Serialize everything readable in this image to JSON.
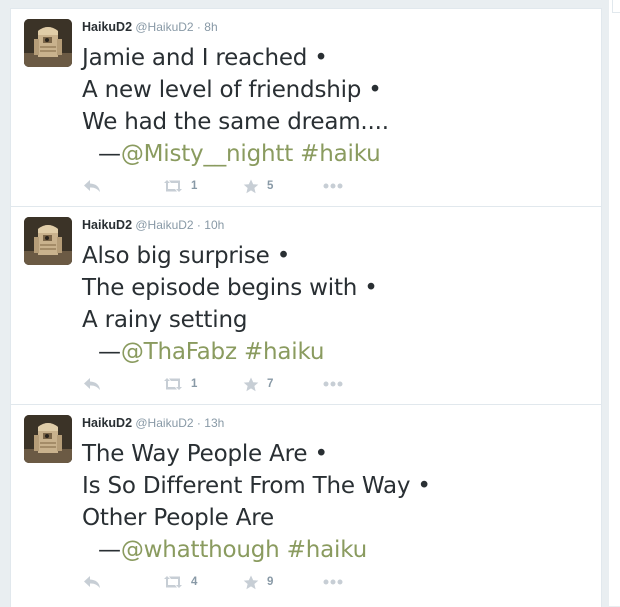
{
  "tweets": [
    {
      "author_name": "HaikuD2",
      "handle": "@HaikuD2",
      "separator": "·",
      "time": "8h",
      "lines": [
        "Jamie and I reached •",
        "A new level of friendship •",
        "We had the same dream...."
      ],
      "dash": "—",
      "mention": "@Misty__nightt",
      "hashtag": "#haiku",
      "retweets": "1",
      "favorites": "5"
    },
    {
      "author_name": "HaikuD2",
      "handle": "@HaikuD2",
      "separator": "·",
      "time": "10h",
      "lines": [
        "Also big surprise •",
        "The episode begins with •",
        "A rainy setting"
      ],
      "dash": "—",
      "mention": "@ThaFabz",
      "hashtag": "#haiku",
      "retweets": "1",
      "favorites": "7"
    },
    {
      "author_name": "HaikuD2",
      "handle": "@HaikuD2",
      "separator": "·",
      "time": "13h",
      "lines": [
        "The Way People Are •",
        "Is So Different From The Way •",
        "Other People Are"
      ],
      "dash": "—",
      "mention": "@whatthough",
      "hashtag": "#haiku",
      "retweets": "4",
      "favorites": "9"
    }
  ],
  "icons": {
    "avatar": "robot-avatar",
    "reply": "reply-icon",
    "retweet": "retweet-icon",
    "favorite": "star-icon",
    "more": "more-icon"
  },
  "colors": {
    "link": "#8a9b5f",
    "meta": "#8899a6",
    "text": "#292f33",
    "action_icon": "#c7ced5"
  }
}
